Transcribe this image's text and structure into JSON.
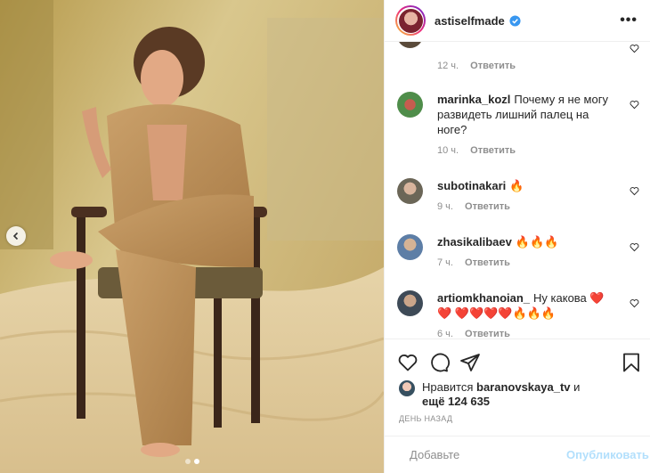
{
  "post": {
    "username": "astiselfmade",
    "verified": true
  },
  "comments": [
    {
      "user": "",
      "text": "",
      "time": "12 ч.",
      "reply": "Ответить",
      "avatar_color": "#5a4a3a"
    },
    {
      "user": "marinka_kozl",
      "text": "Почему я не могу развидеть лишний палец на ноге?",
      "time": "10 ч.",
      "reply": "Ответить",
      "avatar_color": "#4f8d4a"
    },
    {
      "user": "subotinakari",
      "text": "🔥",
      "time": "9 ч.",
      "reply": "Ответить",
      "avatar_color": "#6b6657"
    },
    {
      "user": "zhasikalibaev",
      "text": "🔥🔥🔥",
      "time": "7 ч.",
      "reply": "Ответить",
      "avatar_color": "#5d7ea6"
    },
    {
      "user": "artiomkhanoian_",
      "text": "Ну какова ❤️❤️ ❤️❤️❤️❤️🔥🔥🔥",
      "time": "6 ч.",
      "reply": "Ответить",
      "avatar_color": "#3e4a57"
    }
  ],
  "likes": {
    "prefix": "Нравится",
    "liker": "baranovskaya_tv",
    "suffix": "и",
    "others": "ещё 124 635"
  },
  "date": "ДЕНЬ НАЗАД",
  "add_comment": {
    "placeholder": "Добавьте",
    "publish_label": "Опубликовать"
  },
  "icons": {
    "like": "heart-icon",
    "comment": "comment-icon",
    "share": "share-icon",
    "save": "bookmark-icon",
    "emoji": "emoji-icon",
    "more": "more-icon",
    "prev": "chevron-left-icon"
  },
  "colors": {
    "verified": "#3897f0",
    "publish_disabled": "#b2dffc",
    "meta_gray": "#8e8e8e"
  }
}
